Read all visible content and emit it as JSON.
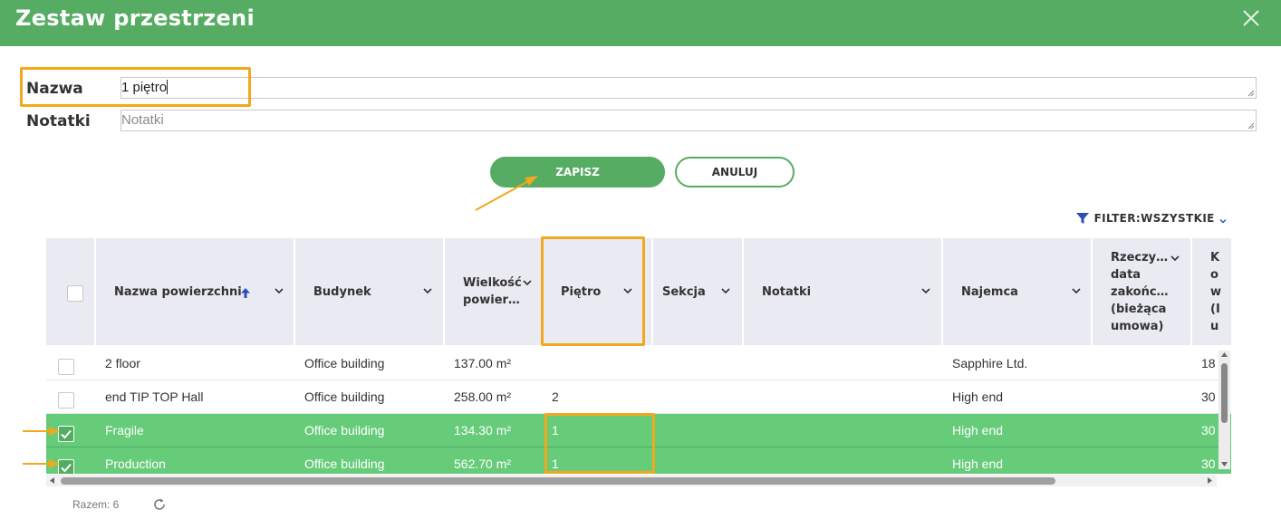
{
  "dialog": {
    "title": "Zestaw przestrzeni",
    "close_icon": "close-icon"
  },
  "form": {
    "name_label": "Nazwa",
    "name_value": "1 piętro",
    "notes_label": "Notatki",
    "notes_placeholder": "Notatki",
    "save_label": "ZAPISZ",
    "cancel_label": "ANULUJ"
  },
  "filter": {
    "label": "FILTER:WSZYSTKIE",
    "icon": "funnel-icon"
  },
  "table": {
    "columns": [
      {
        "label": "Nazwa powierzchni",
        "sort": "ascending"
      },
      {
        "label": "Budynek"
      },
      {
        "label": "Wielkość\npowier…"
      },
      {
        "label": "Piętro"
      },
      {
        "label": "Sekcja"
      },
      {
        "label": "Notatki"
      },
      {
        "label": "Najemca"
      },
      {
        "label": "Rzeczy…\ndata\nzakońc…\n(bieżąca\numowa)"
      },
      {
        "label": "K\no\nw\n(I\nu"
      }
    ],
    "rows": [
      {
        "checked": false,
        "name": "2 floor",
        "building": "Office building",
        "size": "137.00 m²",
        "floor": "",
        "section": "",
        "notes": "",
        "tenant": "Sapphire Ltd.",
        "last": "18"
      },
      {
        "checked": false,
        "name": "end TIP TOP Hall",
        "building": "Office building",
        "size": "258.00 m²",
        "floor": "2",
        "section": "",
        "notes": "",
        "tenant": "High end",
        "last": "30"
      },
      {
        "checked": true,
        "name": "Fragile",
        "building": "Office building",
        "size": "134.30 m²",
        "floor": "1",
        "section": "",
        "notes": "",
        "tenant": "High end",
        "last": "30"
      },
      {
        "checked": true,
        "name": "Production",
        "building": "Office building",
        "size": "562.70 m²",
        "floor": "1",
        "section": "",
        "notes": "",
        "tenant": "High end",
        "last": "30"
      }
    ]
  },
  "footer": {
    "count": "Razem: 6",
    "refresh_icon": "refresh-icon"
  },
  "colors": {
    "header_green": "#55ac62",
    "selected_row": "#66cc7a",
    "annotation_orange": "#f2a81d",
    "header_cell_bg": "#e9eaf2",
    "filter_blue": "#2f4db7"
  }
}
